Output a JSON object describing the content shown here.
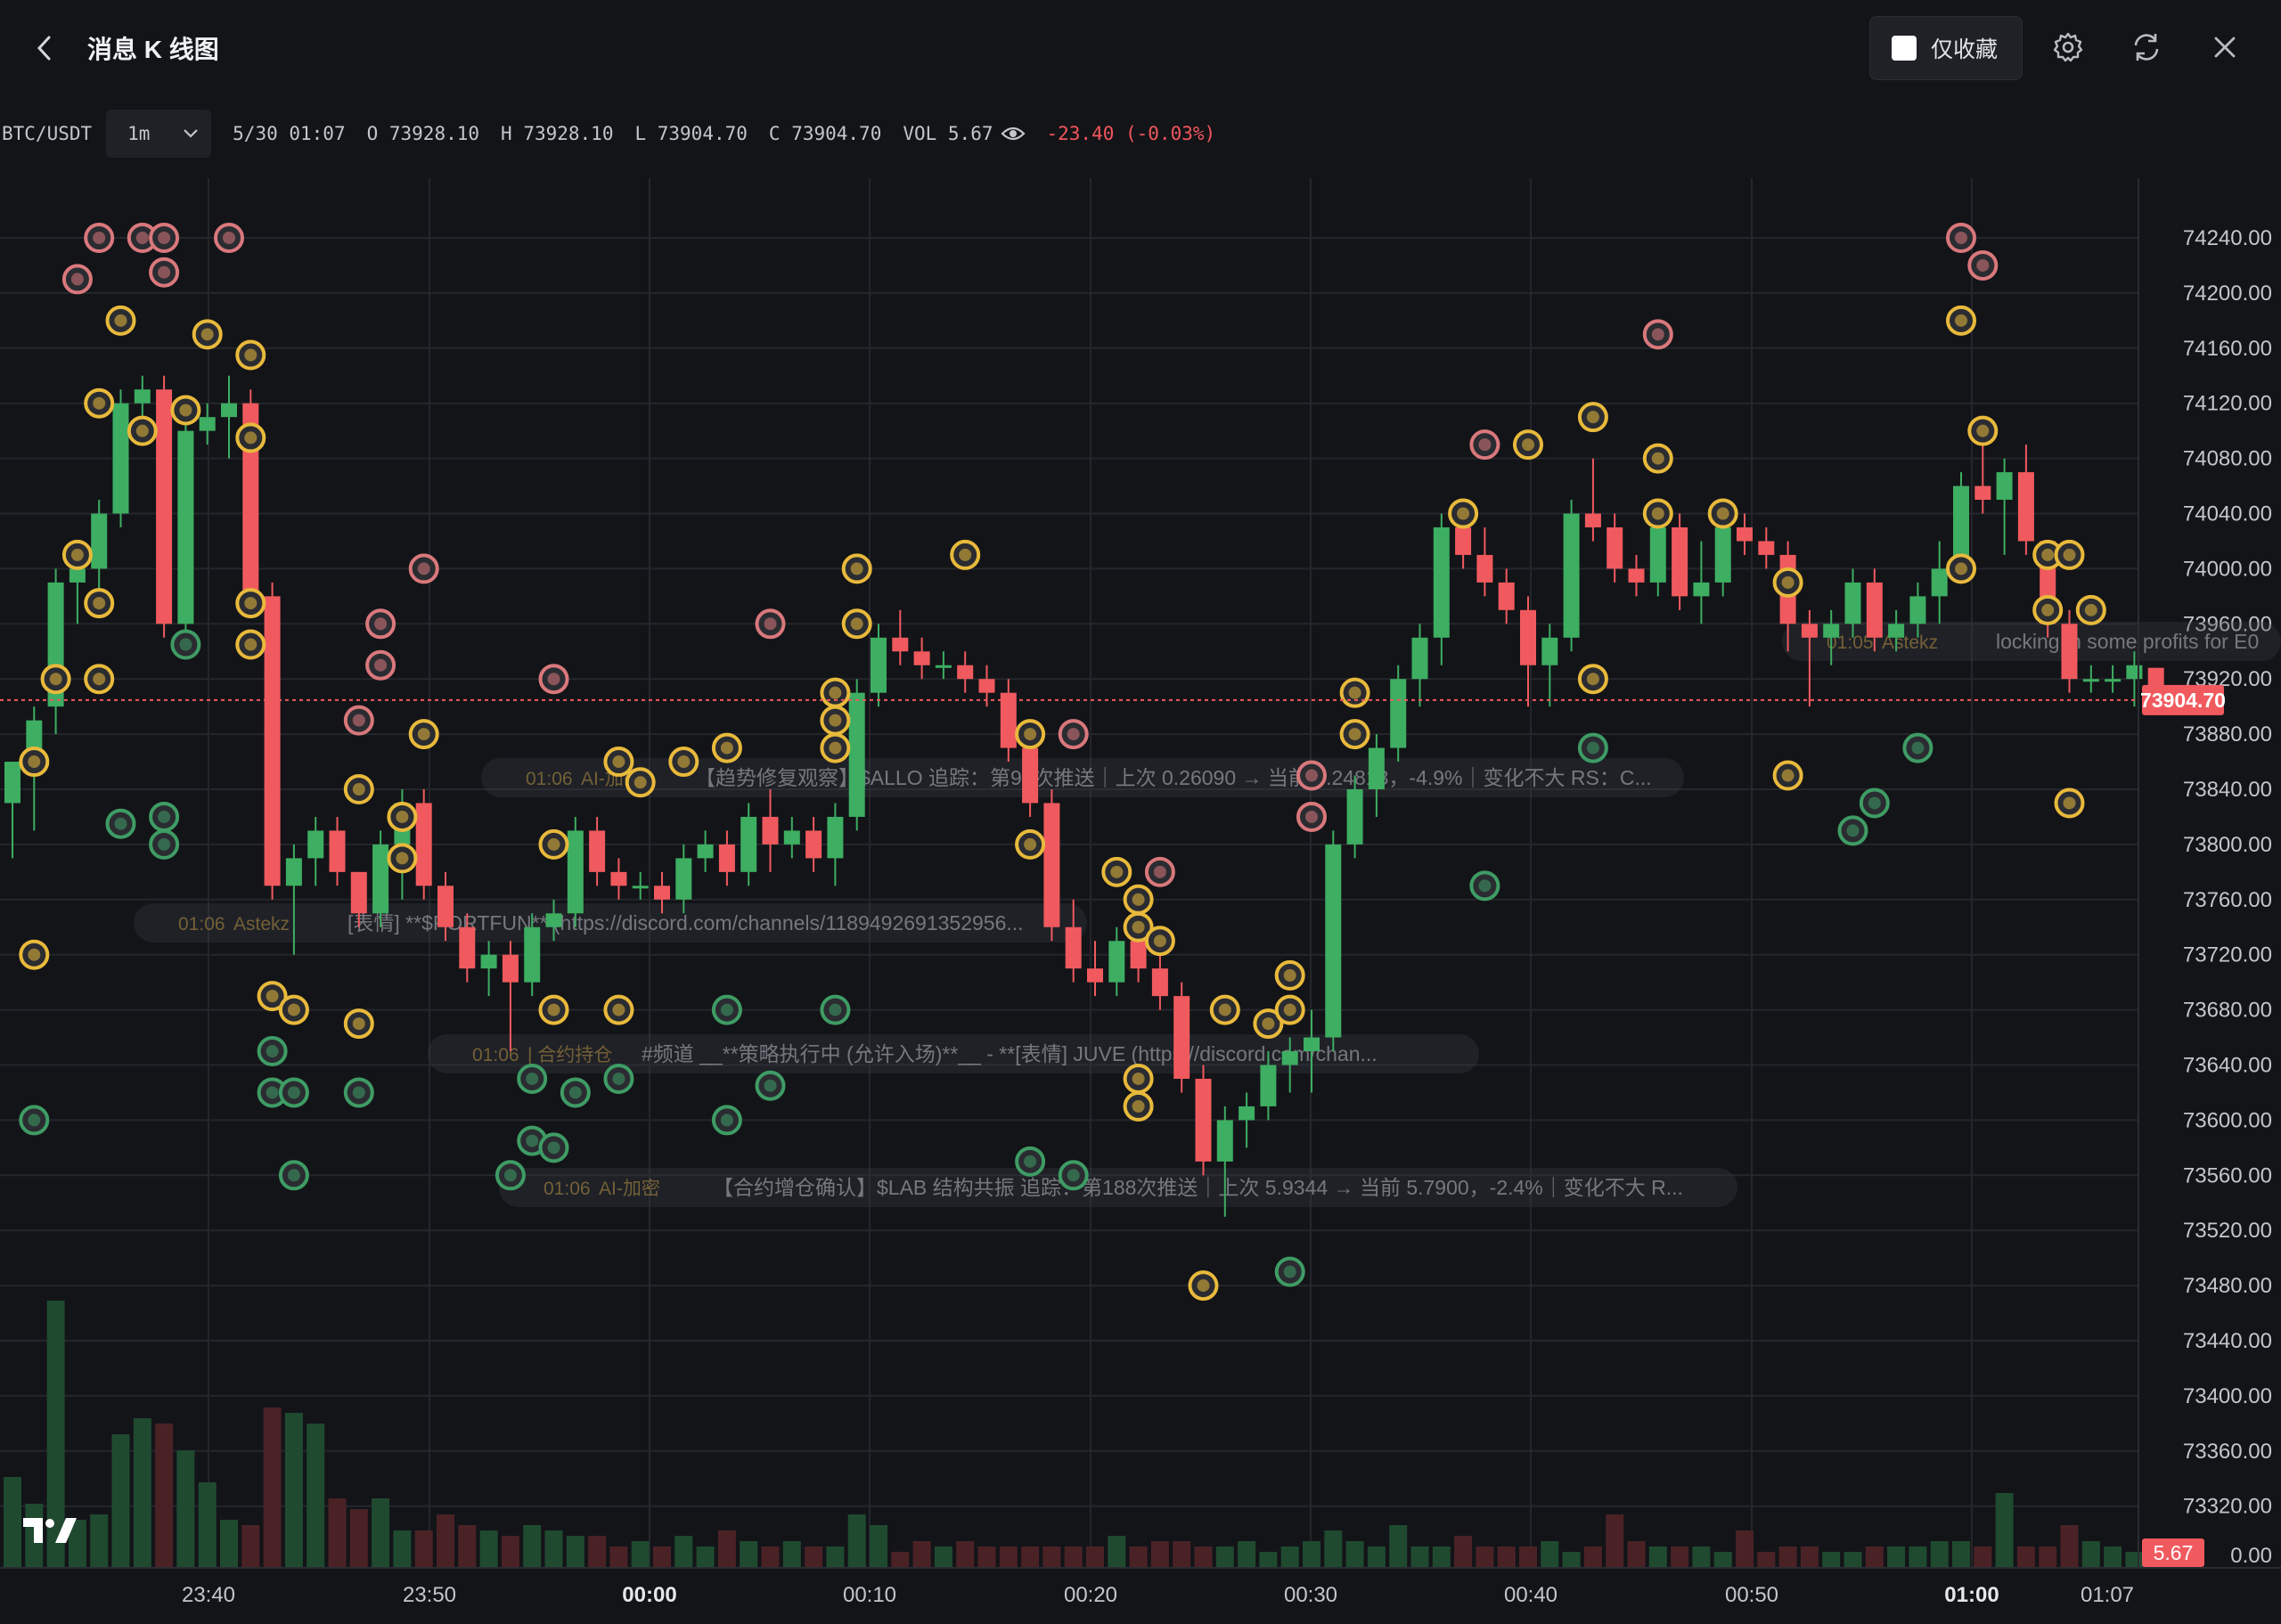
{
  "header": {
    "title": "消息 K 线图",
    "favorites_only_label": "仅收藏",
    "favorites_only_checked": false,
    "icons": [
      "back-arrow-icon",
      "settings-gear-icon",
      "refresh-icon",
      "close-icon"
    ]
  },
  "ohlc_bar": {
    "symbol": "BTC/USDT",
    "timeframe": "1m",
    "datetime": "5/30 01:07",
    "open": "O 73928.10",
    "high": "H 73928.10",
    "low": "L 73904.70",
    "close": "C 73904.70",
    "volume": "VOL 5.67",
    "change": "-23.40 (-0.03%)"
  },
  "colors": {
    "up": "#3dae62",
    "down": "#f05a5e",
    "marker_gold": "#e8b93b",
    "marker_pink": "#d9787c",
    "marker_green": "#3e9c64",
    "last_price_bg": "#f05a5e"
  },
  "last_price": "73904.70",
  "last_volume": "5.67",
  "message_overlays": [
    {
      "time": "01:06",
      "source": "AI-加密",
      "text": "【趋势修复观察】$ALLO 追踪：第96次推送｜上次 0.26090 → 当前 0.24813，-4.9%｜变化不大 RS：C..."
    },
    {
      "time": "01:06",
      "source": "Astekz",
      "text": "[表情] **$PORTFUN** (https://discord.com/channels/11894926913529​56..."
    },
    {
      "time": "01:06",
      "source": "| 合约持仓",
      "text": "#频道 __**策略执行中 (允许入场)**__ - **[表情] JUVE (https://discord.com/chan..."
    },
    {
      "time": "01:06",
      "source": "AI-加密",
      "text": "【合约增仓确认】$LAB 结构共振 追踪：第188次推送｜上次 5.9344 → 当前 5.7900，-2.4%｜变化不大 R..."
    },
    {
      "time": "01:05",
      "source": "Astekz",
      "text": "locking in some profits for E0"
    }
  ],
  "chart_data": {
    "type": "candlestick",
    "price_axis_ticks": [
      "74240.00",
      "74200.00",
      "74160.00",
      "74120.00",
      "74080.00",
      "74040.00",
      "74000.00",
      "73960.00",
      "73920.00",
      "73880.00",
      "73840.00",
      "73800.00",
      "73760.00",
      "73720.00",
      "73680.00",
      "73640.00",
      "73600.00",
      "73560.00",
      "73520.00",
      "73480.00",
      "73440.00",
      "73400.00",
      "73360.00",
      "73320.00",
      "0.00"
    ],
    "time_axis_ticks": [
      {
        "label": "23:40",
        "bold": false
      },
      {
        "label": "23:50",
        "bold": false
      },
      {
        "label": "00:00",
        "bold": true
      },
      {
        "label": "00:10",
        "bold": false
      },
      {
        "label": "00:20",
        "bold": false
      },
      {
        "label": "00:30",
        "bold": false
      },
      {
        "label": "00:40",
        "bold": false
      },
      {
        "label": "00:50",
        "bold": false
      },
      {
        "label": "01:00",
        "bold": true
      },
      {
        "label": "01:07",
        "bold": false
      }
    ],
    "ylim": [
      73300,
      74290
    ],
    "candles": [
      [
        73830,
        73860,
        73790,
        73860
      ],
      [
        73860,
        73900,
        73810,
        73890
      ],
      [
        73900,
        74000,
        73880,
        73990
      ],
      [
        73990,
        74010,
        73960,
        74000
      ],
      [
        74000,
        74050,
        73980,
        74040
      ],
      [
        74040,
        74130,
        74030,
        74120
      ],
      [
        74120,
        74140,
        74100,
        74130
      ],
      [
        74130,
        74140,
        73950,
        73960
      ],
      [
        73960,
        74110,
        73950,
        74100
      ],
      [
        74100,
        74120,
        74090,
        74110
      ],
      [
        74110,
        74140,
        74080,
        74120
      ],
      [
        74120,
        74130,
        73970,
        73980
      ],
      [
        73980,
        73990,
        73760,
        73770
      ],
      [
        73770,
        73800,
        73720,
        73790
      ],
      [
        73790,
        73820,
        73770,
        73810
      ],
      [
        73810,
        73820,
        73770,
        73780
      ],
      [
        73780,
        73780,
        73740,
        73750
      ],
      [
        73750,
        73810,
        73740,
        73800
      ],
      [
        73800,
        73840,
        73760,
        73830
      ],
      [
        73830,
        73840,
        73760,
        73770
      ],
      [
        73770,
        73780,
        73730,
        73740
      ],
      [
        73740,
        73750,
        73700,
        73710
      ],
      [
        73710,
        73730,
        73690,
        73720
      ],
      [
        73720,
        73730,
        73650,
        73700
      ],
      [
        73700,
        73750,
        73690,
        73740
      ],
      [
        73740,
        73760,
        73730,
        73750
      ],
      [
        73750,
        73820,
        73740,
        73810
      ],
      [
        73810,
        73820,
        73770,
        73780
      ],
      [
        73780,
        73790,
        73760,
        73770
      ],
      [
        73770,
        73780,
        73760,
        73770
      ],
      [
        73770,
        73780,
        73750,
        73760
      ],
      [
        73760,
        73800,
        73750,
        73790
      ],
      [
        73790,
        73810,
        73780,
        73800
      ],
      [
        73800,
        73810,
        73770,
        73780
      ],
      [
        73780,
        73830,
        73770,
        73820
      ],
      [
        73820,
        73840,
        73780,
        73800
      ],
      [
        73800,
        73820,
        73790,
        73810
      ],
      [
        73810,
        73820,
        73780,
        73790
      ],
      [
        73790,
        73830,
        73770,
        73820
      ],
      [
        73820,
        73920,
        73810,
        73910
      ],
      [
        73910,
        73960,
        73900,
        73950
      ],
      [
        73950,
        73970,
        73930,
        73940
      ],
      [
        73940,
        73950,
        73920,
        73930
      ],
      [
        73930,
        73940,
        73920,
        73930
      ],
      [
        73930,
        73940,
        73910,
        73920
      ],
      [
        73920,
        73930,
        73900,
        73910
      ],
      [
        73910,
        73920,
        73860,
        73870
      ],
      [
        73870,
        73880,
        73820,
        73830
      ],
      [
        73830,
        73840,
        73730,
        73740
      ],
      [
        73740,
        73760,
        73700,
        73710
      ],
      [
        73710,
        73730,
        73690,
        73700
      ],
      [
        73700,
        73740,
        73690,
        73730
      ],
      [
        73730,
        73750,
        73700,
        73710
      ],
      [
        73710,
        73730,
        73680,
        73690
      ],
      [
        73690,
        73700,
        73620,
        73630
      ],
      [
        73630,
        73640,
        73560,
        73570
      ],
      [
        73570,
        73610,
        73530,
        73600
      ],
      [
        73600,
        73620,
        73580,
        73610
      ],
      [
        73610,
        73650,
        73600,
        73640
      ],
      [
        73640,
        73660,
        73620,
        73650
      ],
      [
        73650,
        73680,
        73620,
        73660
      ],
      [
        73660,
        73810,
        73650,
        73800
      ],
      [
        73800,
        73850,
        73790,
        73840
      ],
      [
        73840,
        73880,
        73820,
        73870
      ],
      [
        73870,
        73930,
        73860,
        73920
      ],
      [
        73920,
        73960,
        73900,
        73950
      ],
      [
        73950,
        74040,
        73930,
        74030
      ],
      [
        74030,
        74050,
        74000,
        74010
      ],
      [
        74010,
        74030,
        73980,
        73990
      ],
      [
        73990,
        74000,
        73960,
        73970
      ],
      [
        73970,
        73980,
        73900,
        73930
      ],
      [
        73930,
        73960,
        73900,
        73950
      ],
      [
        73950,
        74050,
        73940,
        74040
      ],
      [
        74040,
        74080,
        74020,
        74030
      ],
      [
        74030,
        74040,
        73990,
        74000
      ],
      [
        74000,
        74010,
        73980,
        73990
      ],
      [
        73990,
        74040,
        73980,
        74030
      ],
      [
        74030,
        74040,
        73970,
        73980
      ],
      [
        73980,
        74020,
        73960,
        73990
      ],
      [
        73990,
        74040,
        73980,
        74030
      ],
      [
        74030,
        74040,
        74010,
        74020
      ],
      [
        74020,
        74030,
        74000,
        74010
      ],
      [
        74010,
        74020,
        73940,
        73960
      ],
      [
        73960,
        73970,
        73900,
        73950
      ],
      [
        73950,
        73970,
        73930,
        73960
      ],
      [
        73960,
        74000,
        73950,
        73990
      ],
      [
        73990,
        74000,
        73940,
        73950
      ],
      [
        73950,
        73970,
        73940,
        73960
      ],
      [
        73960,
        73990,
        73950,
        73980
      ],
      [
        73980,
        74020,
        73960,
        74000
      ],
      [
        74000,
        74070,
        73990,
        74060
      ],
      [
        74060,
        74110,
        74040,
        74050
      ],
      [
        74050,
        74080,
        74010,
        74070
      ],
      [
        74070,
        74090,
        74010,
        74020
      ],
      [
        74020,
        74020,
        73950,
        73960
      ],
      [
        73960,
        73970,
        73910,
        73920
      ],
      [
        73920,
        73930,
        73910,
        73920
      ],
      [
        73920,
        73930,
        73910,
        73920
      ],
      [
        73920,
        73940,
        73900,
        73930
      ],
      [
        73928.1,
        73928.1,
        73904.7,
        73904.7
      ]
    ],
    "volumes": [
      17,
      12,
      50,
      9,
      10,
      25,
      28,
      27,
      22,
      16,
      9,
      8,
      30,
      29,
      27,
      13,
      11,
      13,
      7,
      7,
      10,
      8,
      7,
      6,
      8,
      7,
      6,
      6,
      4,
      5,
      4,
      6,
      4,
      7,
      5,
      4,
      5,
      4,
      4,
      10,
      8,
      3,
      5,
      4,
      5,
      4,
      4,
      4,
      4,
      4,
      4,
      6,
      4,
      5,
      5,
      4,
      4,
      5,
      3,
      4,
      5,
      7,
      5,
      4,
      8,
      4,
      4,
      6,
      4,
      4,
      4,
      5,
      3,
      4,
      10,
      5,
      4,
      4,
      4,
      3,
      7,
      3,
      4,
      4,
      3,
      3,
      4,
      4,
      4,
      5,
      5,
      4,
      14,
      4,
      4,
      8,
      5,
      4,
      3,
      2
    ],
    "volume_max": 50,
    "message_markers": [
      {
        "t": 4,
        "p": 74240,
        "c": "pink"
      },
      {
        "t": 6,
        "p": 74240,
        "c": "pink"
      },
      {
        "t": 7,
        "p": 74240,
        "c": "pink"
      },
      {
        "t": 10,
        "p": 74240,
        "c": "pink"
      },
      {
        "t": 3,
        "p": 74210,
        "c": "pink"
      },
      {
        "t": 7,
        "p": 74215,
        "c": "pink"
      },
      {
        "t": 5,
        "p": 74180,
        "c": "gold"
      },
      {
        "t": 9,
        "p": 74170,
        "c": "gold"
      },
      {
        "t": 11,
        "p": 74155,
        "c": "gold"
      },
      {
        "t": 4,
        "p": 74120,
        "c": "gold"
      },
      {
        "t": 8,
        "p": 74115,
        "c": "gold"
      },
      {
        "t": 11,
        "p": 74095,
        "c": "gold"
      },
      {
        "t": 6,
        "p": 74100,
        "c": "gold"
      },
      {
        "t": 3,
        "p": 74010,
        "c": "gold"
      },
      {
        "t": 4,
        "p": 73975,
        "c": "gold"
      },
      {
        "t": 11,
        "p": 73975,
        "c": "gold"
      },
      {
        "t": 2,
        "p": 73920,
        "c": "gold"
      },
      {
        "t": 4,
        "p": 73920,
        "c": "gold"
      },
      {
        "t": 8,
        "p": 73945,
        "c": "green"
      },
      {
        "t": 11,
        "p": 73945,
        "c": "gold"
      },
      {
        "t": 1,
        "p": 73860,
        "c": "gold"
      },
      {
        "t": 5,
        "p": 73815,
        "c": "green"
      },
      {
        "t": 7,
        "p": 73820,
        "c": "green"
      },
      {
        "t": 7,
        "p": 73800,
        "c": "green"
      },
      {
        "t": 1,
        "p": 73720,
        "c": "gold"
      },
      {
        "t": 1,
        "p": 73600,
        "c": "green"
      },
      {
        "t": 12,
        "p": 73690,
        "c": "gold"
      },
      {
        "t": 13,
        "p": 73680,
        "c": "gold"
      },
      {
        "t": 12,
        "p": 73650,
        "c": "green"
      },
      {
        "t": 12,
        "p": 73620,
        "c": "green"
      },
      {
        "t": 13,
        "p": 73620,
        "c": "green"
      },
      {
        "t": 16,
        "p": 73620,
        "c": "green"
      },
      {
        "t": 13,
        "p": 73560,
        "c": "green"
      },
      {
        "t": 16,
        "p": 73670,
        "c": "gold"
      },
      {
        "t": 19,
        "p": 74000,
        "c": "pink"
      },
      {
        "t": 17,
        "p": 73960,
        "c": "pink"
      },
      {
        "t": 17,
        "p": 73930,
        "c": "pink"
      },
      {
        "t": 16,
        "p": 73890,
        "c": "pink"
      },
      {
        "t": 19,
        "p": 73880,
        "c": "gold"
      },
      {
        "t": 16,
        "p": 73840,
        "c": "gold"
      },
      {
        "t": 18,
        "p": 73820,
        "c": "gold"
      },
      {
        "t": 18,
        "p": 73790,
        "c": "gold"
      },
      {
        "t": 25,
        "p": 73920,
        "c": "pink"
      },
      {
        "t": 28,
        "p": 73860,
        "c": "gold"
      },
      {
        "t": 29,
        "p": 73845,
        "c": "gold"
      },
      {
        "t": 31,
        "p": 73860,
        "c": "gold"
      },
      {
        "t": 33,
        "p": 73870,
        "c": "gold"
      },
      {
        "t": 25,
        "p": 73800,
        "c": "gold"
      },
      {
        "t": 25,
        "p": 73680,
        "c": "gold"
      },
      {
        "t": 28,
        "p": 73680,
        "c": "gold"
      },
      {
        "t": 33,
        "p": 73680,
        "c": "green"
      },
      {
        "t": 38,
        "p": 73680,
        "c": "green"
      },
      {
        "t": 24,
        "p": 73630,
        "c": "green"
      },
      {
        "t": 26,
        "p": 73620,
        "c": "green"
      },
      {
        "t": 28,
        "p": 73630,
        "c": "green"
      },
      {
        "t": 35,
        "p": 73625,
        "c": "green"
      },
      {
        "t": 33,
        "p": 73600,
        "c": "green"
      },
      {
        "t": 24,
        "p": 73585,
        "c": "green"
      },
      {
        "t": 25,
        "p": 73580,
        "c": "green"
      },
      {
        "t": 23,
        "p": 73560,
        "c": "green"
      },
      {
        "t": 35,
        "p": 73960,
        "c": "pink"
      },
      {
        "t": 39,
        "p": 74000,
        "c": "gold"
      },
      {
        "t": 44,
        "p": 74010,
        "c": "gold"
      },
      {
        "t": 39,
        "p": 73960,
        "c": "gold"
      },
      {
        "t": 38,
        "p": 73910,
        "c": "gold"
      },
      {
        "t": 38,
        "p": 73890,
        "c": "gold"
      },
      {
        "t": 38,
        "p": 73870,
        "c": "gold"
      },
      {
        "t": 47,
        "p": 73880,
        "c": "gold"
      },
      {
        "t": 49,
        "p": 73880,
        "c": "pink"
      },
      {
        "t": 47,
        "p": 73800,
        "c": "gold"
      },
      {
        "t": 51,
        "p": 73780,
        "c": "gold"
      },
      {
        "t": 52,
        "p": 73760,
        "c": "gold"
      },
      {
        "t": 52,
        "p": 73740,
        "c": "gold"
      },
      {
        "t": 53,
        "p": 73730,
        "c": "gold"
      },
      {
        "t": 53,
        "p": 73780,
        "c": "pink"
      },
      {
        "t": 52,
        "p": 73630,
        "c": "gold"
      },
      {
        "t": 52,
        "p": 73610,
        "c": "gold"
      },
      {
        "t": 47,
        "p": 73570,
        "c": "green"
      },
      {
        "t": 49,
        "p": 73560,
        "c": "green"
      },
      {
        "t": 55,
        "p": 73480,
        "c": "gold"
      },
      {
        "t": 59,
        "p": 73490,
        "c": "green"
      },
      {
        "t": 56,
        "p": 73680,
        "c": "gold"
      },
      {
        "t": 58,
        "p": 73670,
        "c": "gold"
      },
      {
        "t": 59,
        "p": 73680,
        "c": "gold"
      },
      {
        "t": 59,
        "p": 73705,
        "c": "gold"
      },
      {
        "t": 60,
        "p": 73820,
        "c": "pink"
      },
      {
        "t": 60,
        "p": 73850,
        "c": "pink"
      },
      {
        "t": 62,
        "p": 73880,
        "c": "gold"
      },
      {
        "t": 62,
        "p": 73910,
        "c": "gold"
      },
      {
        "t": 67,
        "p": 74040,
        "c": "gold"
      },
      {
        "t": 68,
        "p": 74090,
        "c": "pink"
      },
      {
        "t": 70,
        "p": 74090,
        "c": "gold"
      },
      {
        "t": 68,
        "p": 73770,
        "c": "green"
      },
      {
        "t": 73,
        "p": 74110,
        "c": "gold"
      },
      {
        "t": 76,
        "p": 74170,
        "c": "pink"
      },
      {
        "t": 76,
        "p": 74080,
        "c": "gold"
      },
      {
        "t": 76,
        "p": 74040,
        "c": "gold"
      },
      {
        "t": 73,
        "p": 73920,
        "c": "gold"
      },
      {
        "t": 73,
        "p": 73870,
        "c": "green"
      },
      {
        "t": 79,
        "p": 74040,
        "c": "gold"
      },
      {
        "t": 82,
        "p": 73990,
        "c": "gold"
      },
      {
        "t": 82,
        "p": 73850,
        "c": "gold"
      },
      {
        "t": 85,
        "p": 73810,
        "c": "green"
      },
      {
        "t": 86,
        "p": 73830,
        "c": "green"
      },
      {
        "t": 88,
        "p": 73870,
        "c": "green"
      },
      {
        "t": 90,
        "p": 74240,
        "c": "pink"
      },
      {
        "t": 91,
        "p": 74220,
        "c": "pink"
      },
      {
        "t": 90,
        "p": 74180,
        "c": "gold"
      },
      {
        "t": 91,
        "p": 74100,
        "c": "gold"
      },
      {
        "t": 90,
        "p": 74000,
        "c": "gold"
      },
      {
        "t": 94,
        "p": 74010,
        "c": "gold"
      },
      {
        "t": 95,
        "p": 74010,
        "c": "gold"
      },
      {
        "t": 94,
        "p": 73970,
        "c": "gold"
      },
      {
        "t": 96,
        "p": 73970,
        "c": "gold"
      },
      {
        "t": 95,
        "p": 73830,
        "c": "gold"
      }
    ]
  }
}
